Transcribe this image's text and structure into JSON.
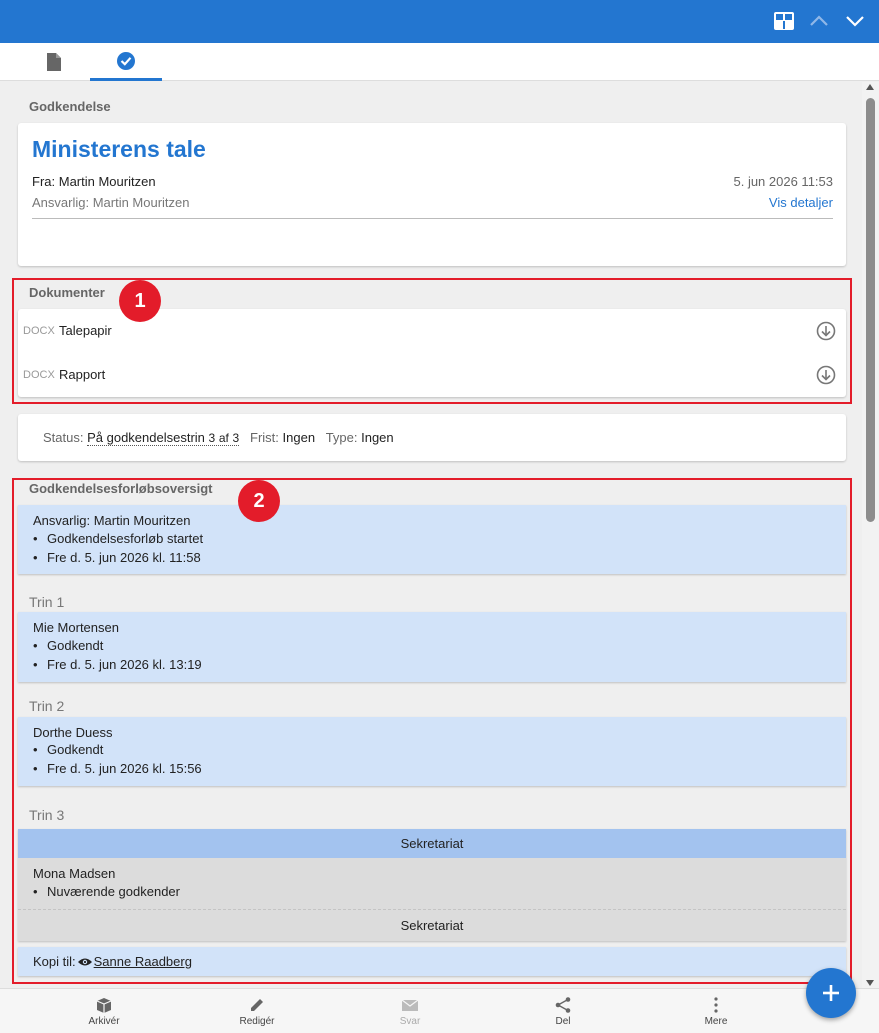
{
  "approval": {
    "section_label": "Godkendelse",
    "title": "Ministerens tale",
    "from_label": "Fra:",
    "from_name": "Martin Mouritzen",
    "date": "5. jun 2026 11:53",
    "responsible": "Ansvarlig: Martin Mouritzen",
    "details_link": "Vis detaljer"
  },
  "documents": {
    "section_label": "Dokumenter",
    "items": [
      {
        "type": "DOCX",
        "name": "Talepapir"
      },
      {
        "type": "DOCX",
        "name": "Rapport"
      }
    ]
  },
  "status": {
    "status_label": "Status:",
    "status_value": "På godkendelsestrin",
    "step_current": "3",
    "step_of": "af",
    "step_total": "3",
    "deadline_label": "Frist:",
    "deadline_value": "Ingen",
    "type_label": "Type:",
    "type_value": "Ingen"
  },
  "overview": {
    "section_label": "Godkendelsesforløbsoversigt",
    "start": {
      "responsible": "Ansvarlig: Martin Mouritzen",
      "line1": "Godkendelsesforløb startet",
      "line2": "Fre d. 5. jun 2026 kl. 11:58"
    },
    "steps": [
      {
        "label": "Trin 1",
        "name": "Mie Mortensen",
        "status": "Godkendt",
        "time": "Fre d. 5. jun 2026 kl. 13:19"
      },
      {
        "label": "Trin 2",
        "name": "Dorthe Duess",
        "status": "Godkendt",
        "time": "Fre d. 5. jun 2026 kl. 15:56"
      }
    ],
    "step3": {
      "label": "Trin 3",
      "group_header": "Sekretariat",
      "name": "Mona Madsen",
      "status": "Nuværende godkender",
      "group_footer": "Sekretariat"
    },
    "copy": {
      "label": "Kopi til:",
      "name": "Sanne Raadberg"
    }
  },
  "annotations": [
    "1",
    "2"
  ],
  "bottom_bar": {
    "archive": "Arkivér",
    "edit": "Redigér",
    "reply": "Svar",
    "share": "Del",
    "more": "Mere"
  },
  "colors": {
    "accent": "#2376d0",
    "highlight": "#e31c2a",
    "step_bg": "#d2e3f9",
    "group_header_bg": "#a3c3ef"
  }
}
